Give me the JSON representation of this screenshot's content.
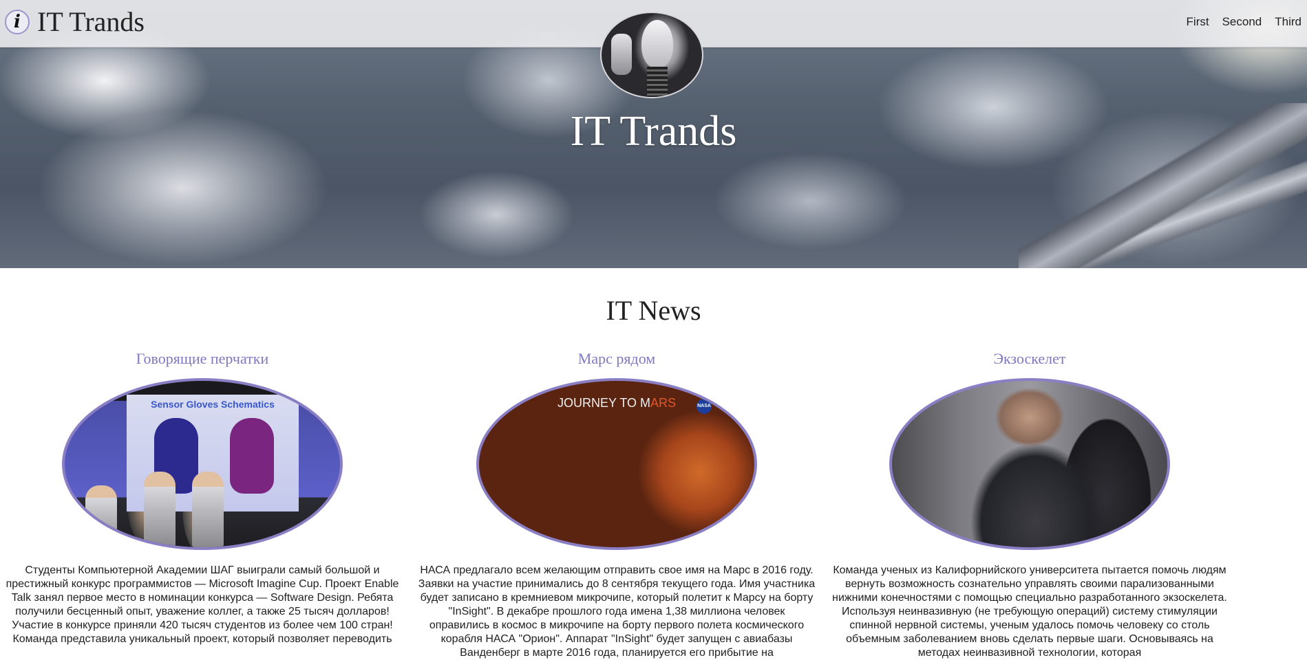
{
  "navbar": {
    "icon_glyph": "i",
    "brand": "IT Trands",
    "links": [
      "First",
      "Second",
      "Third"
    ]
  },
  "hero": {
    "title": "IT Trands",
    "avatar_icon": "robot-avatar-image",
    "background_image": "clouds-spaceship-image"
  },
  "news": {
    "title": "IT News",
    "cards": [
      {
        "heading": "Говорящие перчатки",
        "image_name": "sensor-gloves-image",
        "image_caption": "Sensor Gloves Schematics",
        "text": "Студенты Компьютерной Академии ШАГ выиграли самый большой и престижный конкурс программистов — Microsoft Imagine Cup. Проект Enable Talk занял первое место в номинации конкурса — Software Design. Ребята получили бесценный опыт, уважение коллег, а также 25 тысяч долларов! Участие в конкурсе приняли 420 тысяч студентов из более чем 100 стран! Команда представила уникальный проект, который позволяет переводить"
      },
      {
        "heading": "Марс рядом",
        "image_name": "journey-to-mars-image",
        "image_caption_main": "JOURNEY TO M",
        "image_caption_accent": "ARS",
        "image_badge": "NASA",
        "text": "НАСА предлагало всем желающим отправить свое имя на Марс в 2016 году. Заявки на участие принимались до 8 сентября текущего года. Имя участника будет записано в кремниевом микрочипе, который полетит к Марсу на борту \"InSight\". В декабре прошлого года имена 1,38 миллиона человек оправились в космос в микрочипе на борту первого полета космического корабля НАСА \"Орион\". Аппарат \"InSight\" будет запущен с авиабазы Ванденберг в марте 2016 года, планируется его прибытие на"
      },
      {
        "heading": "Экзоскелет",
        "image_name": "exoskeleton-image",
        "text": "Команда ученых из Калифорнийского университета пытается помочь людям вернуть возможность сознательно управлять своими парализованными нижними конечностями с помощью специально разработанного экзоскелета. Используя неинвазивную (не требующую операций) систему стимуляции спинной нервной системы, ученым удалось помочь человеку со столь объемным заболеванием вновь сделать первые шаги. Основываясь на методах неинвазивной технологии, которая"
      }
    ]
  },
  "colors": {
    "accent": "#7e78c0",
    "image_border": "#8a7fc4",
    "navbar_bg": "#eeeef0"
  }
}
